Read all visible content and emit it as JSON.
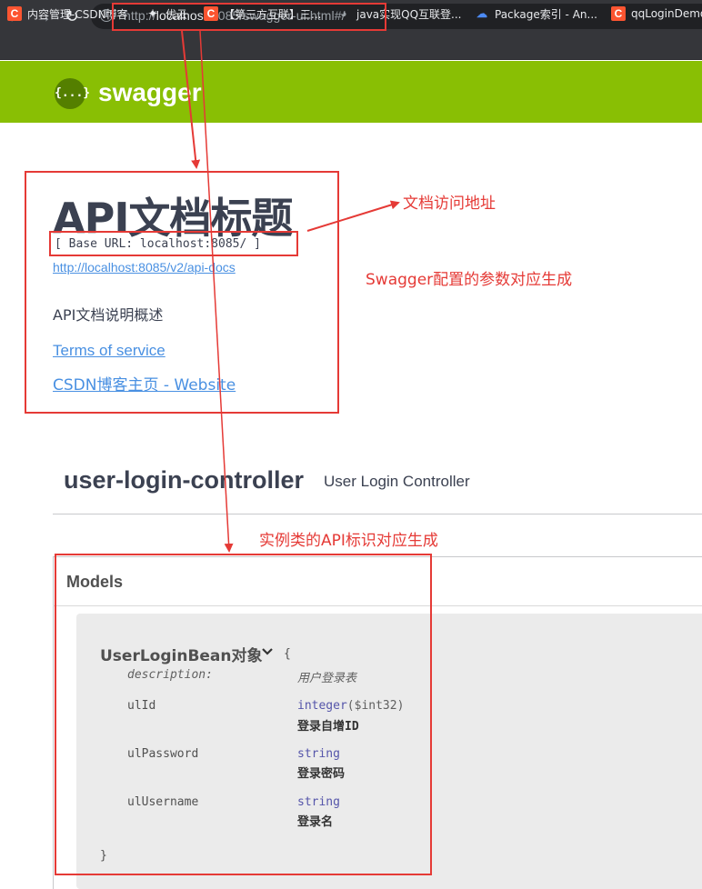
{
  "browser": {
    "url_prefix": "http://",
    "url_host": "localhost",
    "url_rest": ":8085/swagger-ui.html#/",
    "nav_back_icon": "arrow-left-icon",
    "nav_forward_icon": "arrow-right-icon",
    "reload_icon": "reload-icon",
    "info_icon": "info-icon",
    "bookmarks": [
      {
        "label": "内容管理-CSDN博客",
        "icon": "csdn-icon"
      },
      {
        "label": "优云",
        "icon": "youyun-icon"
      },
      {
        "label": "【第三方互联】三...",
        "icon": "csdn-icon"
      },
      {
        "label": "java实现QQ互联登...",
        "icon": "github-icon"
      },
      {
        "label": "Package索引 - An...",
        "icon": "cloud-icon"
      },
      {
        "label": "qqLoginDemo",
        "icon": "csdn-icon"
      }
    ]
  },
  "swagger": {
    "logo_text": "{...}",
    "brand": "swagger"
  },
  "info": {
    "title": "API文档标题",
    "base_url": "[ Base URL: localhost:8085/ ]",
    "api_docs_url": "http://localhost:8085/v2/api-docs",
    "description": "API文档说明概述",
    "terms": "Terms of service",
    "website": "CSDN博客主页 - Website"
  },
  "tag": {
    "name": "user-login-controller",
    "description": "User Login Controller"
  },
  "models": {
    "title": "Models",
    "model_name": "UserLoginBean对象",
    "open_brace": "{",
    "close_brace": "}",
    "description_label": "description:",
    "description_value": "用户登录表",
    "properties": [
      {
        "name": "ulId",
        "type": "integer",
        "format": "($int32)",
        "desc": "登录自增ID"
      },
      {
        "name": "ulPassword",
        "type": "string",
        "format": "",
        "desc": "登录密码"
      },
      {
        "name": "ulUsername",
        "type": "string",
        "format": "",
        "desc": "登录名"
      }
    ]
  },
  "annotations": {
    "doc_url": "文档访问地址",
    "swagger_params": "Swagger配置的参数对应生成",
    "api_marks": "实例类的API标识对应生成",
    "color": "#e53a36"
  },
  "colors": {
    "swagger_green": "#89bf04",
    "link_blue": "#4990e2",
    "chrome_dark": "#35363a"
  }
}
